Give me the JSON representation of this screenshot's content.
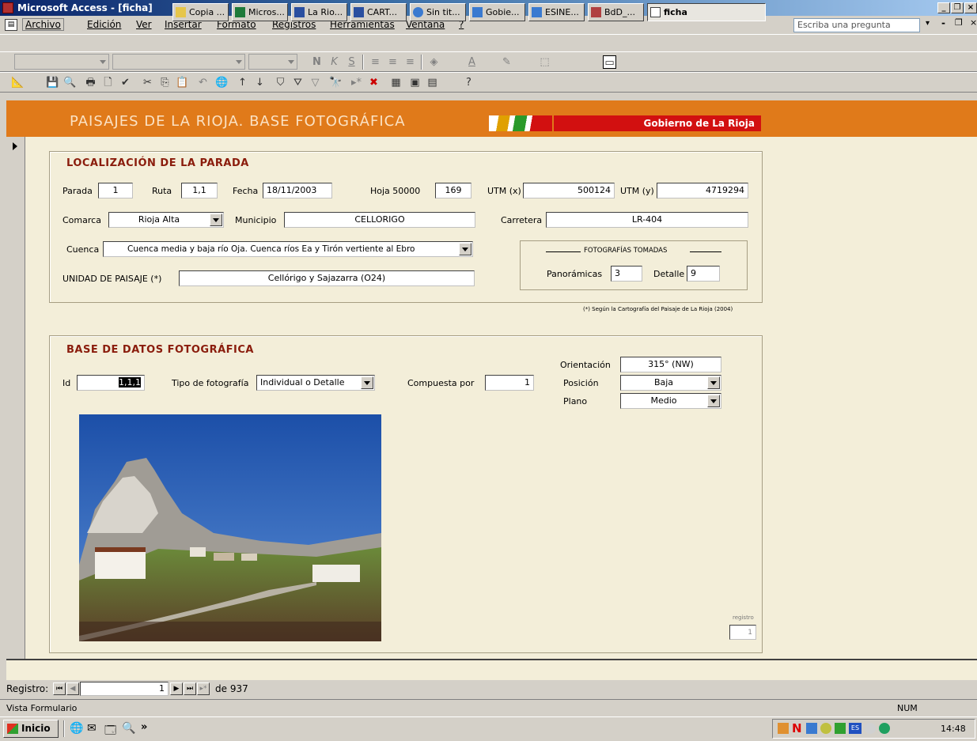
{
  "window": {
    "title": "Microsoft Access - [ficha]"
  },
  "menu": {
    "items": [
      "Archivo",
      "Edición",
      "Ver",
      "Insertar",
      "Formato",
      "Registros",
      "Herramientas",
      "Ventana",
      "?"
    ],
    "ask_placeholder": "Escriba una pregunta"
  },
  "banner": {
    "title": "PAISAJES DE LA RIOJA. BASE FOTOGRÁFICA",
    "logo_text": "Gobierno de La Rioja"
  },
  "localizacion": {
    "title": "LOCALIZACIÓN DE LA PARADA",
    "parada_label": "Parada",
    "parada": "1",
    "ruta_label": "Ruta",
    "ruta": "1,1",
    "fecha_label": "Fecha",
    "fecha": "18/11/2003",
    "hoja_label": "Hoja 50000",
    "hoja": "169",
    "utmx_label": "UTM (x)",
    "utmx": "500124",
    "utmy_label": "UTM (y)",
    "utmy": "4719294",
    "comarca_label": "Comarca",
    "comarca": "Rioja Alta",
    "municipio_label": "Municipio",
    "municipio": "CELLORIGO",
    "carretera_label": "Carretera",
    "carretera": "LR-404",
    "cuenca_label": "Cuenca",
    "cuenca": "Cuenca media y baja río Oja. Cuenca ríos Ea y Tirón vertiente al Ebro",
    "unidad_label": "UNIDAD DE PAISAJE (*)",
    "unidad": "Cellórigo y Sajazarra (O24)",
    "fotos_title": "FOTOGRAFÍAS TOMADAS",
    "panoramicas_label": "Panorámicas",
    "panoramicas": "3",
    "detalle_label": "Detalle",
    "detalle": "9",
    "footnote": "(*) Según la Cartografía del Paisaje de La Rioja (2004)"
  },
  "base": {
    "title": "BASE DE DATOS FOTOGRÁFICA",
    "id_label": "Id",
    "id": "1,1,1",
    "tipo_label": "Tipo de fotografía",
    "tipo": "Individual o Detalle",
    "compuesta_label": "Compuesta por",
    "compuesta": "1",
    "orientacion_label": "Orientación",
    "orientacion": "315° (NW)",
    "posicion_label": "Posición",
    "posicion": "Baja",
    "plano_label": "Plano",
    "plano": "Medio",
    "registro_label": "registro",
    "registro": "1"
  },
  "nav": {
    "label": "Registro:",
    "current": "1",
    "of": "de 937"
  },
  "status": {
    "left": "Vista Formulario",
    "num": "NUM"
  },
  "taskbar": {
    "start": "Inicio",
    "tasks": [
      "Copia ...",
      "Micros...",
      "La Rio...",
      "CART...",
      "Sin tit...",
      "Gobie...",
      "ESINE...",
      "BdD_...",
      "ficha"
    ],
    "time": "14:48"
  },
  "colors": {
    "banner": "#e07a1a",
    "form_bg": "#f3eed9",
    "title_red": "#8a1c0c"
  }
}
